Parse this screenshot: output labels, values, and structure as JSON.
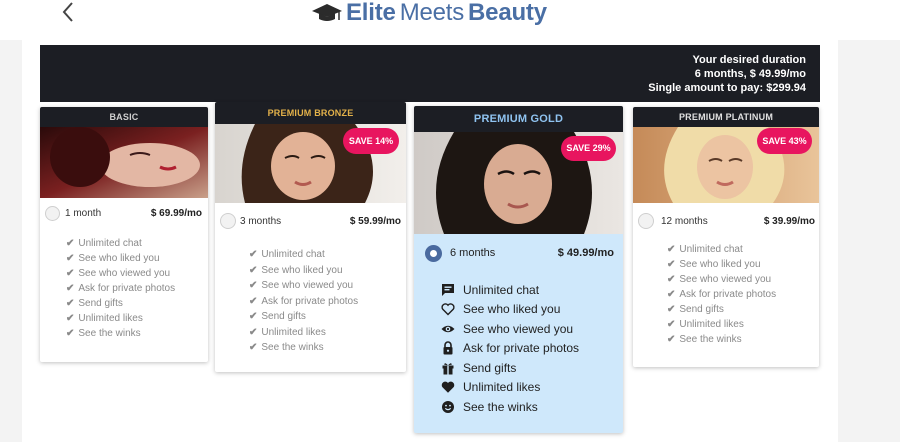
{
  "header": {
    "logo": {
      "part1": "Elite",
      "part2": "Meets",
      "part3": "Beauty"
    }
  },
  "summary": {
    "line1": "Your desired duration",
    "line2": "6 months, $ 49.99/mo",
    "line3": "Single amount to pay: $299.94"
  },
  "plans": [
    {
      "name": "BASIC",
      "save": "",
      "duration": "1 month",
      "price": "$ 69.99/mo",
      "selected": false,
      "features": [
        "Unlimited chat",
        "See who liked you",
        "See who viewed you",
        "Ask for private photos",
        "Send gifts",
        "Unlimited likes",
        "See the winks"
      ]
    },
    {
      "name": "PREMIUM BRONZE",
      "save": "SAVE 14%",
      "duration": "3 months",
      "price": "$ 59.99/mo",
      "selected": false,
      "features": [
        "Unlimited chat",
        "See who liked you",
        "See who viewed you",
        "Ask for private photos",
        "Send gifts",
        "Unlimited likes",
        "See the winks"
      ]
    },
    {
      "name": "PREMIUM GOLD",
      "save": "SAVE 29%",
      "duration": "6 months",
      "price": "$ 49.99/mo",
      "selected": true,
      "features": [
        "Unlimited chat",
        "See who liked you",
        "See who viewed you",
        "Ask for private photos",
        "Send gifts",
        "Unlimited likes",
        "See the winks"
      ]
    },
    {
      "name": "PREMIUM PLATINUM",
      "save": "SAVE 43%",
      "duration": "12 months",
      "price": "$ 39.99/mo",
      "selected": false,
      "features": [
        "Unlimited chat",
        "See who liked you",
        "See who viewed you",
        "Ask for private photos",
        "Send gifts",
        "Unlimited likes",
        "See the winks"
      ]
    }
  ],
  "icons": {
    "back": "chevron-left-icon",
    "logo": "graduation-cap-icon",
    "check": "check-icon",
    "gold_features": [
      "chat-icon",
      "heart-outline-icon",
      "eye-icon",
      "lock-icon",
      "gift-icon",
      "heart-icon",
      "smiley-icon"
    ]
  },
  "colors": {
    "brand_blue": "#4a6fa5",
    "dark_bar": "#1c1e24",
    "save_badge": "#e8155f",
    "gold_card_bg": "#cfe8fb",
    "bronze_label": "#e4b24a",
    "gold_label": "#8fc3f0"
  }
}
